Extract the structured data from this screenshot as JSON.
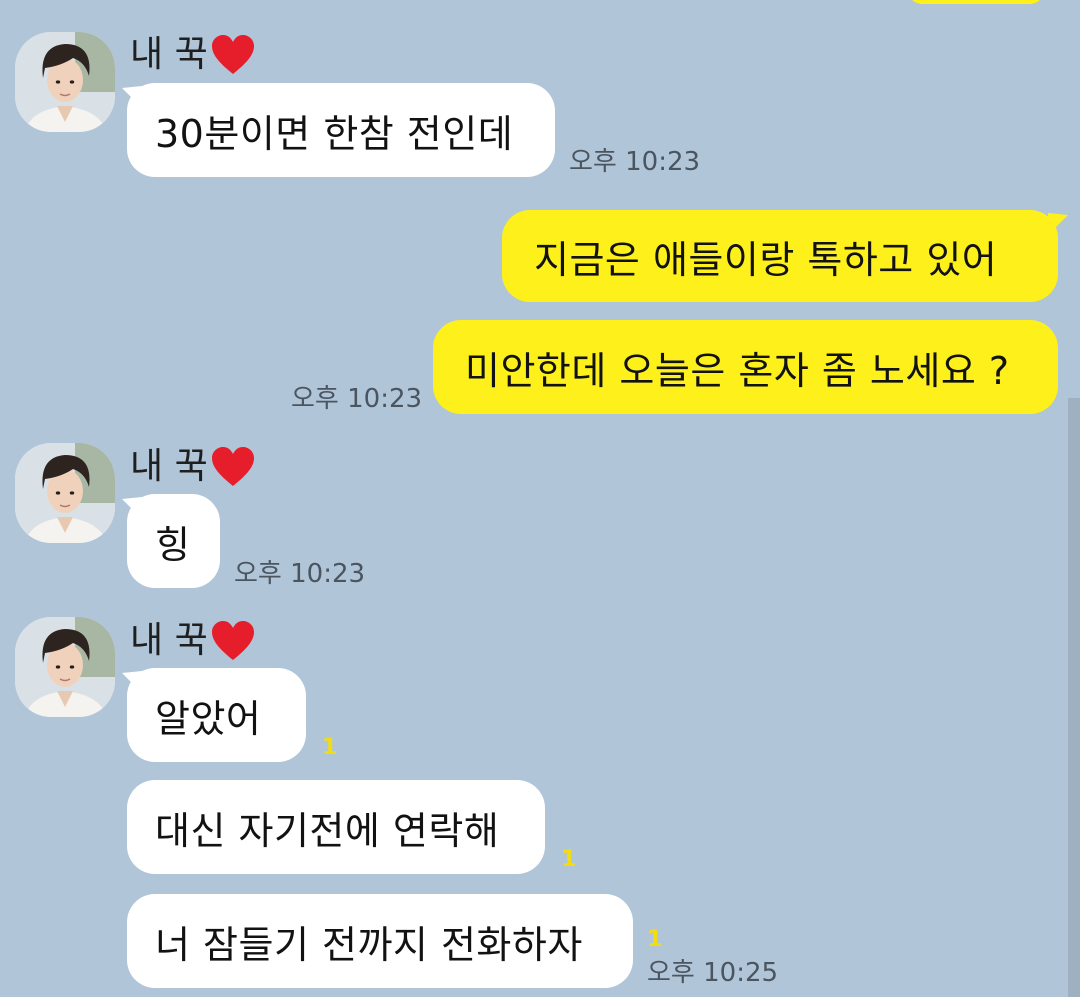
{
  "contact": {
    "name": "내 꾹",
    "avatar_icon": "profile-photo-icon",
    "heart_icon": "red-heart-icon"
  },
  "colors": {
    "background": "#b1c5d9",
    "outgoing_bubble": "#fef01b",
    "incoming_bubble": "#ffffff",
    "unread": "#f2dc12"
  },
  "messages": [
    {
      "sender": "contact",
      "text": "30분이면 한참 전인데",
      "time": "오후 10:23"
    },
    {
      "sender": "me",
      "text": "지금은 애들이랑 톡하고 있어"
    },
    {
      "sender": "me",
      "text": "미안한데 오늘은 혼자 좀 노세요 ?",
      "time": "오후 10:23"
    },
    {
      "sender": "contact",
      "text": "힝",
      "time": "오후 10:23"
    },
    {
      "sender": "contact",
      "text": "알았어",
      "unread": "1"
    },
    {
      "sender": "contact",
      "text": "대신 자기전에 연락해",
      "unread": "1"
    },
    {
      "sender": "contact",
      "text": "너 잠들기 전까지 전화하자",
      "unread": "1",
      "time": "오후 10:25"
    }
  ]
}
